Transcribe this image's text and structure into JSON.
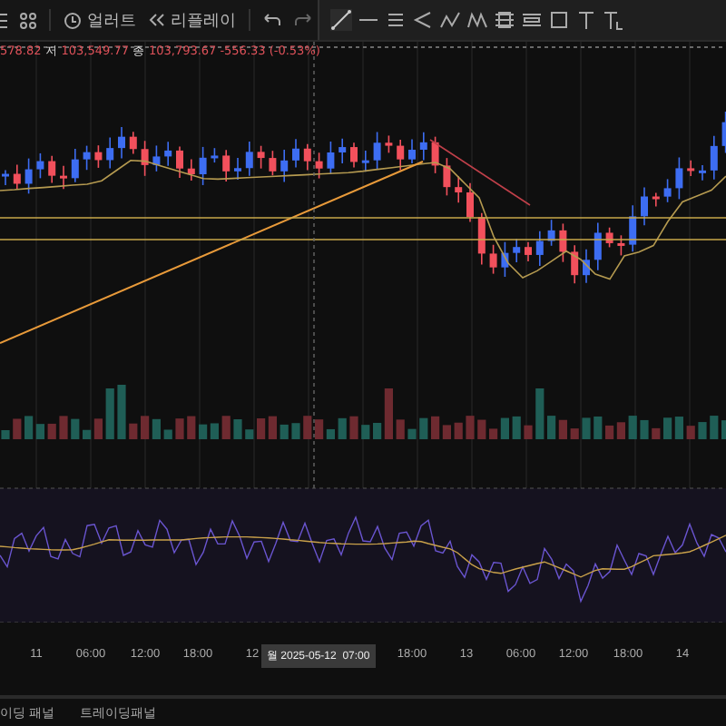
{
  "toolbar": {
    "alert_label": "얼러트",
    "replay_label": "리플레이"
  },
  "drawing_tools": [
    {
      "kind": "line"
    },
    {
      "kind": "cross"
    },
    {
      "kind": "hlines"
    },
    {
      "kind": "angle"
    },
    {
      "kind": "wave"
    },
    {
      "kind": "wave2"
    },
    {
      "kind": "fib"
    },
    {
      "kind": "fib2"
    },
    {
      "kind": "rect"
    },
    {
      "kind": "text"
    },
    {
      "kind": "text2"
    }
  ],
  "legend": {
    "lead": "578.82",
    "low_label": "저",
    "low": "103,549.77",
    "close_label": "종",
    "close": "103,793.67",
    "change": "-556.33 (-0.53%)"
  },
  "time_axis": {
    "labels": [
      "11",
      "06:00",
      "12:00",
      "18:00",
      "12",
      "18:00",
      "13",
      "06:00",
      "12:00",
      "18:00",
      "14"
    ],
    "crosshair_label": "월 2025-05-12  07:00"
  },
  "bottom_tabs": [
    {
      "label": "이딩 패널",
      "selected": false
    },
    {
      "label": "트레이딩패널",
      "selected": false
    }
  ]
}
